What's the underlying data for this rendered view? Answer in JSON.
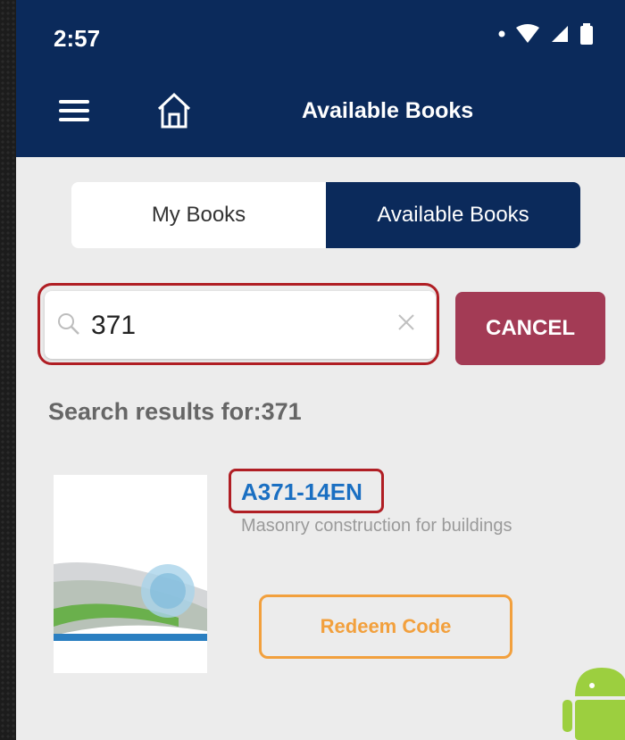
{
  "status_bar": {
    "time": "2:57"
  },
  "toolbar": {
    "title": "Available Books"
  },
  "segment": {
    "my_books": "My Books",
    "available_books": "Available Books"
  },
  "search": {
    "value": "371",
    "cancel_label": "CANCEL"
  },
  "results": {
    "heading": "Search results for:371",
    "items": [
      {
        "code": "A371-14EN",
        "title": "Masonry construction for buildings",
        "action": "Redeem Code"
      }
    ]
  },
  "colors": {
    "appbar": "#0b2a5b",
    "cancel": "#a33b55",
    "link": "#1a6fc2",
    "redeem": "#f2a03d",
    "highlight": "#b01e24"
  }
}
